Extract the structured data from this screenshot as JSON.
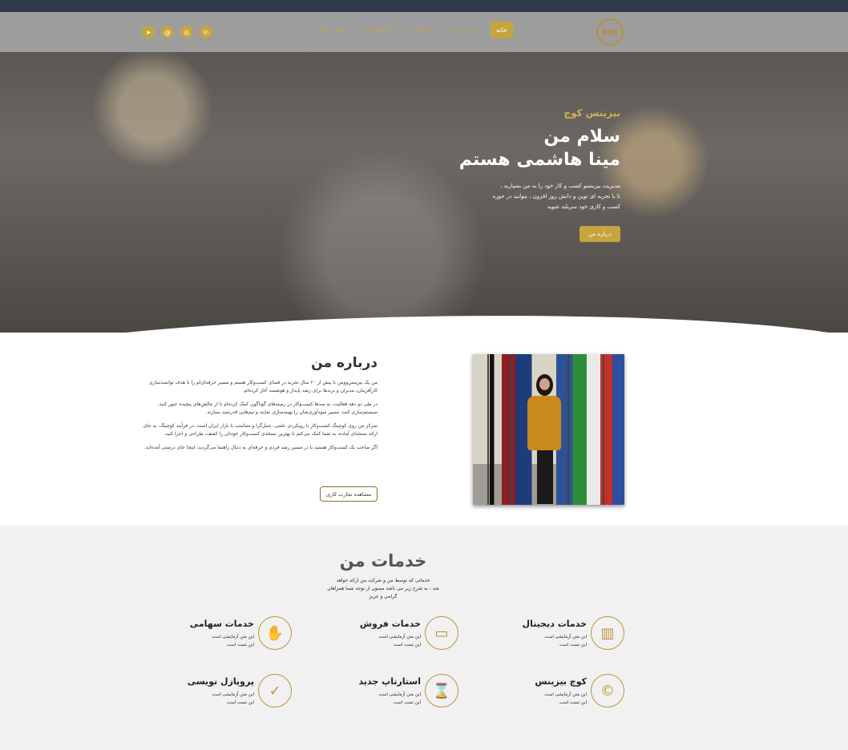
{
  "header": {
    "logo_text": "",
    "nav": [
      "خانه",
      "درباره من",
      "خدمات من",
      "ارتباط با من",
      "تجارب کاری"
    ],
    "socials": [
      "telegram-icon",
      "email-icon",
      "instagram-icon",
      "linkedin-icon"
    ],
    "colors": {
      "accent": "#c8a43f",
      "topbar": "#2f3a4c",
      "header": "#9d9d9d"
    }
  },
  "hero": {
    "subtitle": "بیزینس کوچ",
    "title_line1": "سلام من",
    "title_line2": "مینا هاشمی هستم",
    "desc_line1": "مدیریت بیزینسو کسب و کار خود را به من بسپارید ،",
    "desc_line2": "تا با تجربه ای نوین و دانش روز افزون ، بتوانید در حوزه",
    "desc_line3": "کسب و کاری خود سربلند شوید",
    "button": "درباره من"
  },
  "about": {
    "title": "درباره من",
    "p1": "من یک بیزینس‌وومن با بیش از ۲۰ سال تجربه در فضای کسب‌وکار هستم و مسیر حرفه‌ای‌ام را با هدف توانمندسازی کارآفرینان، مدیران و برندها برای رشد پایدار و هوشمند آغاز کرده‌ام.",
    "p2": "در طی دو دهه فعالیت، به صدها کسب‌وکار در زمینه‌های گوناگون کمک کرده‌ام تا از چالش‌های پیچیده عبور کنند، سیستم‌سازی کنند، مسیر سودآوری‌شان را بهینه‌سازی نمایند و تیم‌هایی قدرتمند بسازند.",
    "p3": "تمرکز من روی کوچینگ کسب‌وکار با رویکردی علمی، عمل‌گرا و متناسب با بازار ایران است. در فرآیند کوچینگ، به جای ارائه نسخه‌ای آماده، به شما کمک می‌کنم تا بهترین نسخه‌ی کسب‌وکار خودتان را کشف، طراحی و اجرا کنید.",
    "p4": "اگر صاحب یک کسب‌وکار هستید یا در مسیر رشد فردی و حرفه‌ای به دنبال راهنما می‌گردید، اینجا جای درستی آمده‌اید.",
    "button": "مشاهده تجارب کاری"
  },
  "services": {
    "title": "خدمات من",
    "intro_line1": "خدماتی که توسط من و شرکت من ارائه خواهد",
    "intro_line2": "شد ، به شرح زیر می باشد ممنون از توجه شما همراهان",
    "intro_line3": "گرامی و عزیز",
    "items": [
      {
        "title": "خدمات دیجیتال",
        "icon": "chart-icon",
        "line1": "این متن آزمایشی است",
        "line2": "این تست است"
      },
      {
        "title": "خدمات فروش",
        "icon": "money-icon",
        "line1": "این متن آزمایشی است",
        "line2": "این تست است"
      },
      {
        "title": "خدمات سهامی",
        "icon": "handshake-icon",
        "line1": "این متن آزمایشی است",
        "line2": "این تست است"
      },
      {
        "title": "کوچ بیزینس",
        "icon": "copyright-icon",
        "line1": "این متن آزمایشی است",
        "line2": "این تست است"
      },
      {
        "title": "استارتاپ جدید",
        "icon": "hourglass-icon",
        "line1": "این متن آزمایشی است",
        "line2": "این تست است"
      },
      {
        "title": "پروپازل نویسی",
        "icon": "clipboard-check-icon",
        "line1": "این متن آزمایشی است",
        "line2": "این تست است"
      }
    ]
  }
}
